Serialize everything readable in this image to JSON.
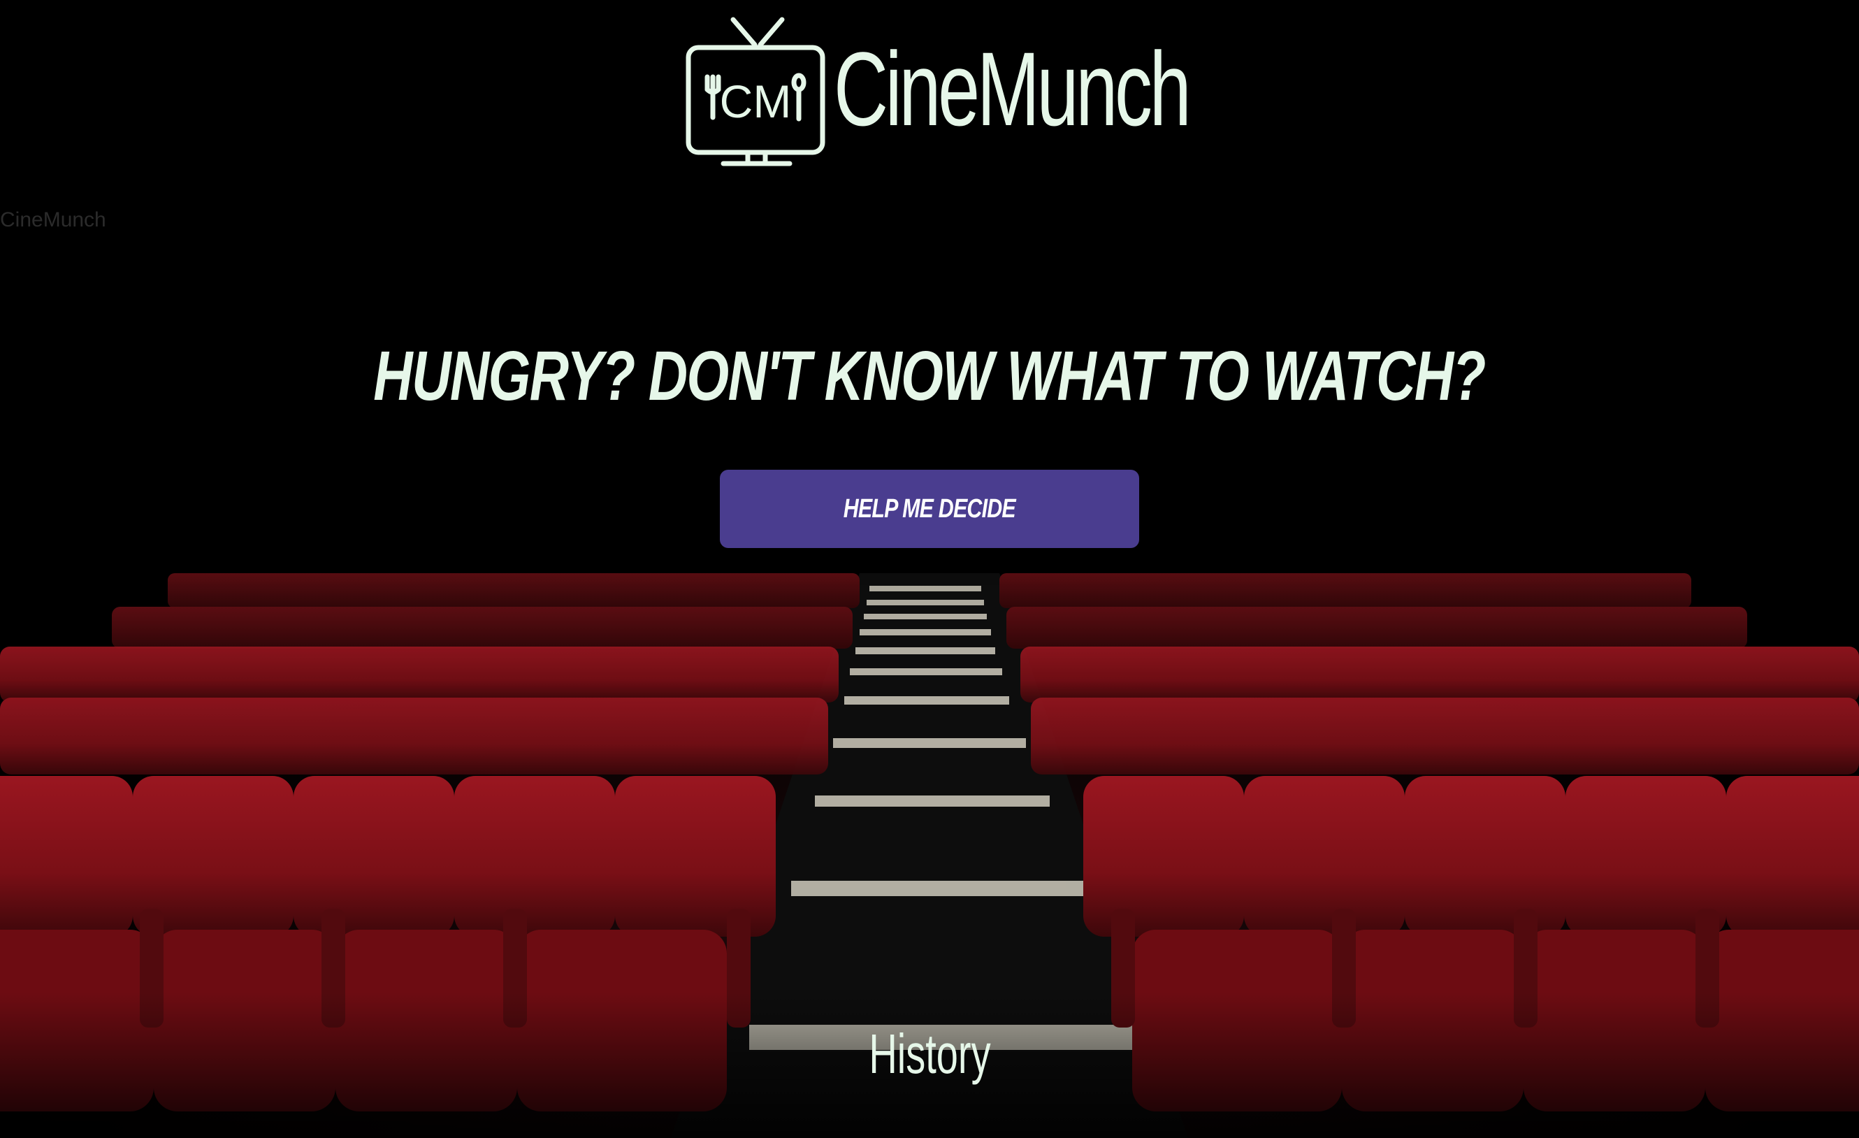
{
  "brand": {
    "name": "CineMunch",
    "logo_monogram": "CM",
    "alt_text": "CineMunch"
  },
  "hero": {
    "headline": "HUNGRY? DON'T KNOW WHAT TO WATCH?",
    "cta_label": "HELP ME DECIDE"
  },
  "footer": {
    "history_label": "History"
  },
  "colors": {
    "text": "#e6f7e9",
    "button": "#4a3d8f",
    "background": "#000000",
    "seat": "#8c1218"
  },
  "icons": {
    "logo": "tv-fork-spoon-icon"
  }
}
